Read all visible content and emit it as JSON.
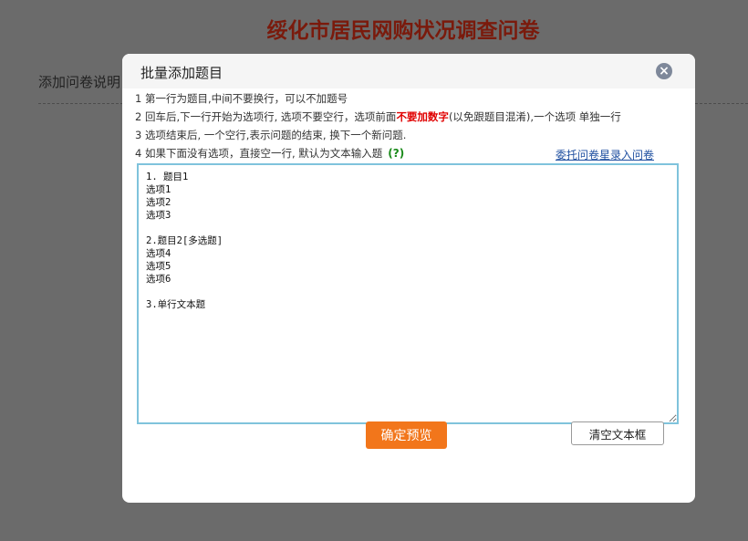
{
  "page": {
    "title": "绥化市居民网购状况调查问卷",
    "description_label": "添加问卷说明"
  },
  "dialog": {
    "title": "批量添加题目",
    "close_icon": "close-icon",
    "instructions": {
      "line1": "1 第一行为题目,中间不要换行，可以不加题号",
      "line2_prefix": "2 回车后,下一行开始为选项行, 选项不要空行，选项前面",
      "line2_highlight": "不要加数字",
      "line2_suffix": "(以免跟题目混淆),一个选项 单独一行",
      "line3": "3 选项结束后, 一个空行,表示问题的结束, 换下一个新问题.",
      "line4": "4 如果下面没有选项，直接空一行, 默认为文本输入题",
      "help_mark": "(?)"
    },
    "delegate_link": "委托问卷星录入问卷",
    "textarea_value": "1. 题目1\n选项1\n选项2\n选项3\n\n2.题目2[多选题]\n选项4\n选项5\n选项6\n\n3.单行文本题",
    "confirm_button": "确定预览",
    "clear_button": "清空文本框"
  },
  "colors": {
    "overlay": "#6b6b6b",
    "title_dark_red": "#7a1a0c",
    "accent_orange": "#f2761b",
    "highlight_red": "#e00000",
    "link_blue": "#1f4fa0",
    "textarea_border": "#7fc3dc"
  }
}
